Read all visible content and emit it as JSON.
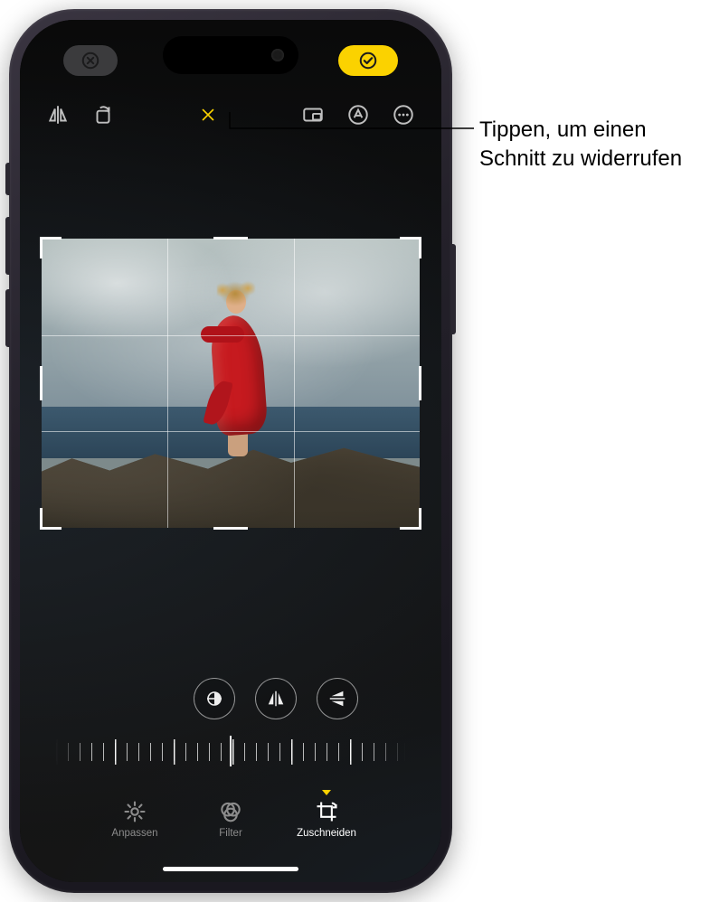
{
  "callout": {
    "text": "Tippen, um einen Schnitt zu widerrufen"
  },
  "status": {
    "cancel_icon": "cancel-circle",
    "done_icon": "check-circle"
  },
  "top_toolbar": {
    "flip": "flip-horizontal",
    "rotate": "rotate",
    "reset": "reset-crop",
    "aspect": "aspect-ratio",
    "markup": "markup",
    "more": "more"
  },
  "crop_tools": {
    "straighten": "straighten",
    "flip_h": "flip-horizontal",
    "flip_v": "flip-vertical"
  },
  "tabs": {
    "adjust": {
      "label": "Anpassen"
    },
    "filter": {
      "label": "Filter"
    },
    "crop": {
      "label": "Zuschneiden",
      "active": true
    }
  },
  "colors": {
    "accent": "#fbd200"
  }
}
